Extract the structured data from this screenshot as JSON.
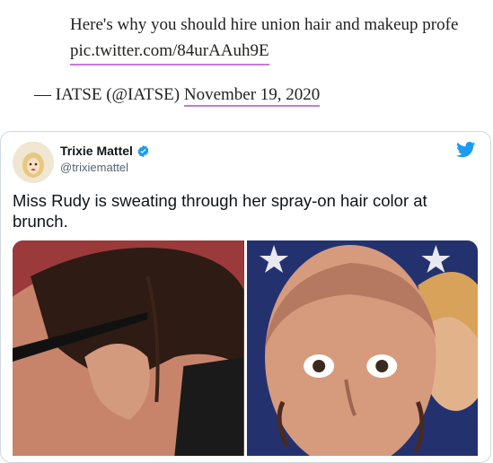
{
  "embed": {
    "quote_text": "Here's why you should hire union hair and makeup profe",
    "pic_link": "pic.twitter.com/84urAAuh9E",
    "attribution_prefix": "— IATSE (@IATSE)",
    "attribution_date": "November 19, 2020"
  },
  "tweet": {
    "display_name": "Trixie Mattel",
    "handle": "@trixiemattel",
    "text": "Miss Rudy is sweating through her spray-on hair color at brunch.",
    "verified": true,
    "brand_color": "#1d9bf0"
  },
  "icons": {
    "verified": "verified-badge-icon",
    "twitter": "twitter-bird-icon"
  },
  "colors": {
    "link_underline": "#c77ad6",
    "card_border": "#cfd9de"
  }
}
